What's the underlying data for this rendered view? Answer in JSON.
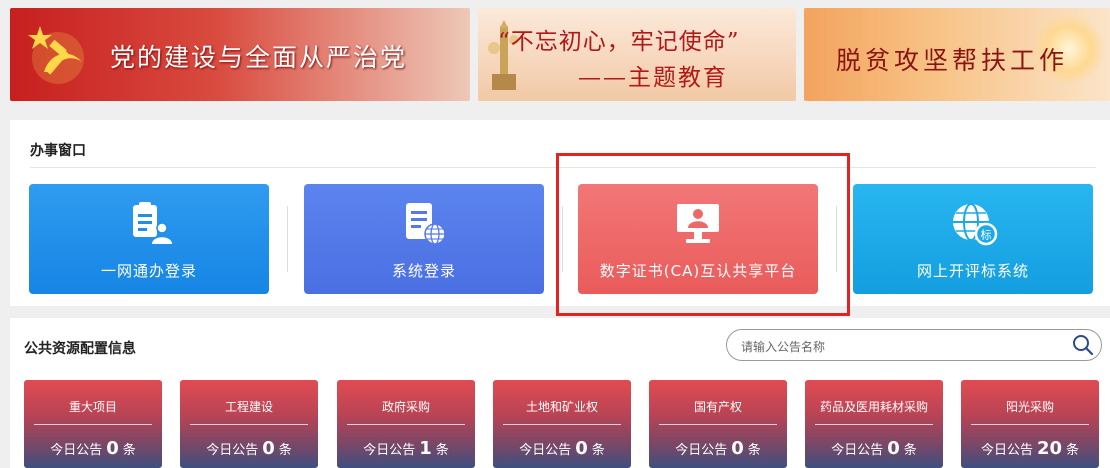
{
  "banners": [
    {
      "text": "党的建设与全面从严治党"
    },
    {
      "line1": "“不忘初心，牢记使命”",
      "line2": "——主题教育"
    },
    {
      "text": "脱贫攻坚帮扶工作"
    }
  ],
  "service_window": {
    "title": "办事窗口",
    "items": [
      {
        "label": "一网通办登录",
        "icon": "clipboard-user-icon",
        "color": "#1f8ee9"
      },
      {
        "label": "系统登录",
        "icon": "document-globe-icon",
        "color": "#5479ea"
      },
      {
        "label": "数字证书(CA)互认共享平台",
        "icon": "monitor-user-icon",
        "color": "#ee6868"
      },
      {
        "label": "网上开评标系统",
        "icon": "globe-bid-icon",
        "color": "#1da9e8"
      }
    ],
    "highlight_color": "#e32222"
  },
  "public_resources": {
    "title": "公共资源配置信息",
    "search_placeholder": "请输入公告名称",
    "categories": [
      {
        "title": "重大项目",
        "prefix": "今日公告",
        "count": "0",
        "suffix": "条"
      },
      {
        "title": "工程建设",
        "prefix": "今日公告",
        "count": "0",
        "suffix": "条"
      },
      {
        "title": "政府采购",
        "prefix": "今日公告",
        "count": "1",
        "suffix": "条"
      },
      {
        "title": "土地和矿业权",
        "prefix": "今日公告",
        "count": "0",
        "suffix": "条"
      },
      {
        "title": "国有产权",
        "prefix": "今日公告",
        "count": "0",
        "suffix": "条"
      },
      {
        "title": "药品及医用耗材采购",
        "prefix": "今日公告",
        "count": "0",
        "suffix": "条"
      },
      {
        "title": "阳光采购",
        "prefix": "今日公告",
        "count": "20",
        "suffix": "条"
      }
    ]
  }
}
